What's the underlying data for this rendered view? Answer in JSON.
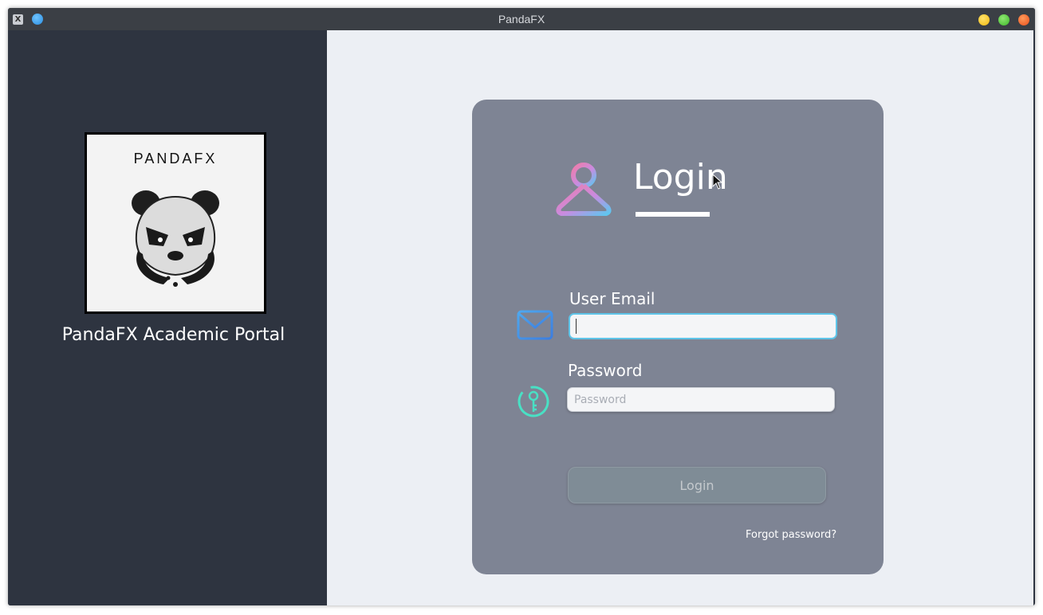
{
  "window": {
    "title": "PandaFX"
  },
  "sidebar": {
    "logo_text": "PANDAFX",
    "portal_title": "PandaFX Academic Portal"
  },
  "login_card": {
    "heading": "Login",
    "email": {
      "label": "User Email",
      "value": "",
      "placeholder": ""
    },
    "password": {
      "label": "Password",
      "value": "",
      "placeholder": "Password"
    },
    "login_button": "Login",
    "forgot_link": "Forgot password?"
  },
  "icons": {
    "user": "user-icon",
    "mail": "mail-icon",
    "key": "key-icon"
  },
  "colors": {
    "sidebar_bg": "#2e3440",
    "main_bg": "#eceff4",
    "card_bg": "#7e8494",
    "focus_border": "#5ec4e8",
    "button_bg": "#7f8c96"
  }
}
